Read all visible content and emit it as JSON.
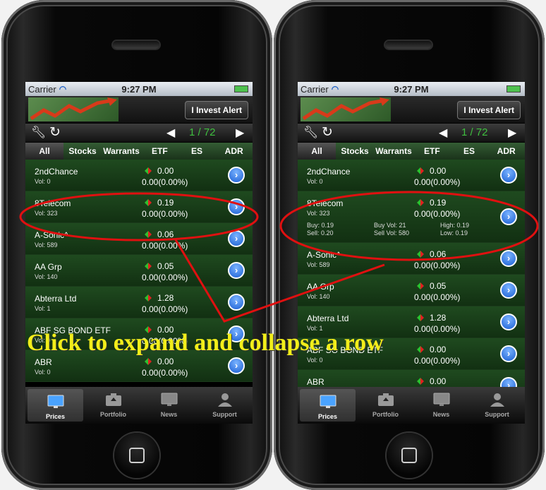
{
  "status": {
    "carrier": "Carrier",
    "time": "9:27 PM"
  },
  "header": {
    "alert_button": "I Invest Alert"
  },
  "toolbar": {
    "page": "1 / 72"
  },
  "tabs": [
    "All",
    "Stocks",
    "Warrants",
    "ETF",
    "ES",
    "ADR"
  ],
  "rows": [
    {
      "name": "2ndChance",
      "vol": "Vol: 0",
      "price": "0.00",
      "change": "0.00(0.00%)"
    },
    {
      "name": "8Telecom",
      "vol": "Vol: 323",
      "price": "0.19",
      "change": "0.00(0.00%)"
    },
    {
      "name": "A-Sonic^",
      "vol": "Vol: 589",
      "price": "0.06",
      "change": "0.00(0.00%)"
    },
    {
      "name": "AA Grp",
      "vol": "Vol: 140",
      "price": "0.05",
      "change": "0.00(0.00%)"
    },
    {
      "name": "Abterra Ltd",
      "vol": "Vol: 1",
      "price": "1.28",
      "change": "0.00(0.00%)"
    },
    {
      "name": "ABF SG BOND ETF",
      "vol": "Vol: 0",
      "price": "0.00",
      "change": "0.00(0.00%)"
    },
    {
      "name": "ABR",
      "vol": "Vol: 0",
      "price": "0.00",
      "change": "0.00(0.00%)"
    }
  ],
  "expanded_detail": {
    "buy": "Buy: 0.19",
    "sell": "Sell: 0.20",
    "buy_vol": "Buy Vol: 21",
    "sell_vol": "Sell Vol: 580",
    "high": "High: 0.19",
    "low": "Low: 0.19"
  },
  "tabbar": [
    "Prices",
    "Portfolio",
    "News",
    "Support"
  ],
  "caption": "Click to expand and collapse a row",
  "colors": {
    "row_green": "#1f4a1f",
    "accent_green": "#3fbf3f",
    "caption_yellow": "#f2ee1a",
    "circle_red": "#e01010"
  },
  "icons": {
    "wrench": "wrench-icon",
    "refresh": "refresh-icon",
    "prev": "triangle-left-icon",
    "next": "triangle-right-icon",
    "detail": "chevron-right-circle-icon"
  }
}
